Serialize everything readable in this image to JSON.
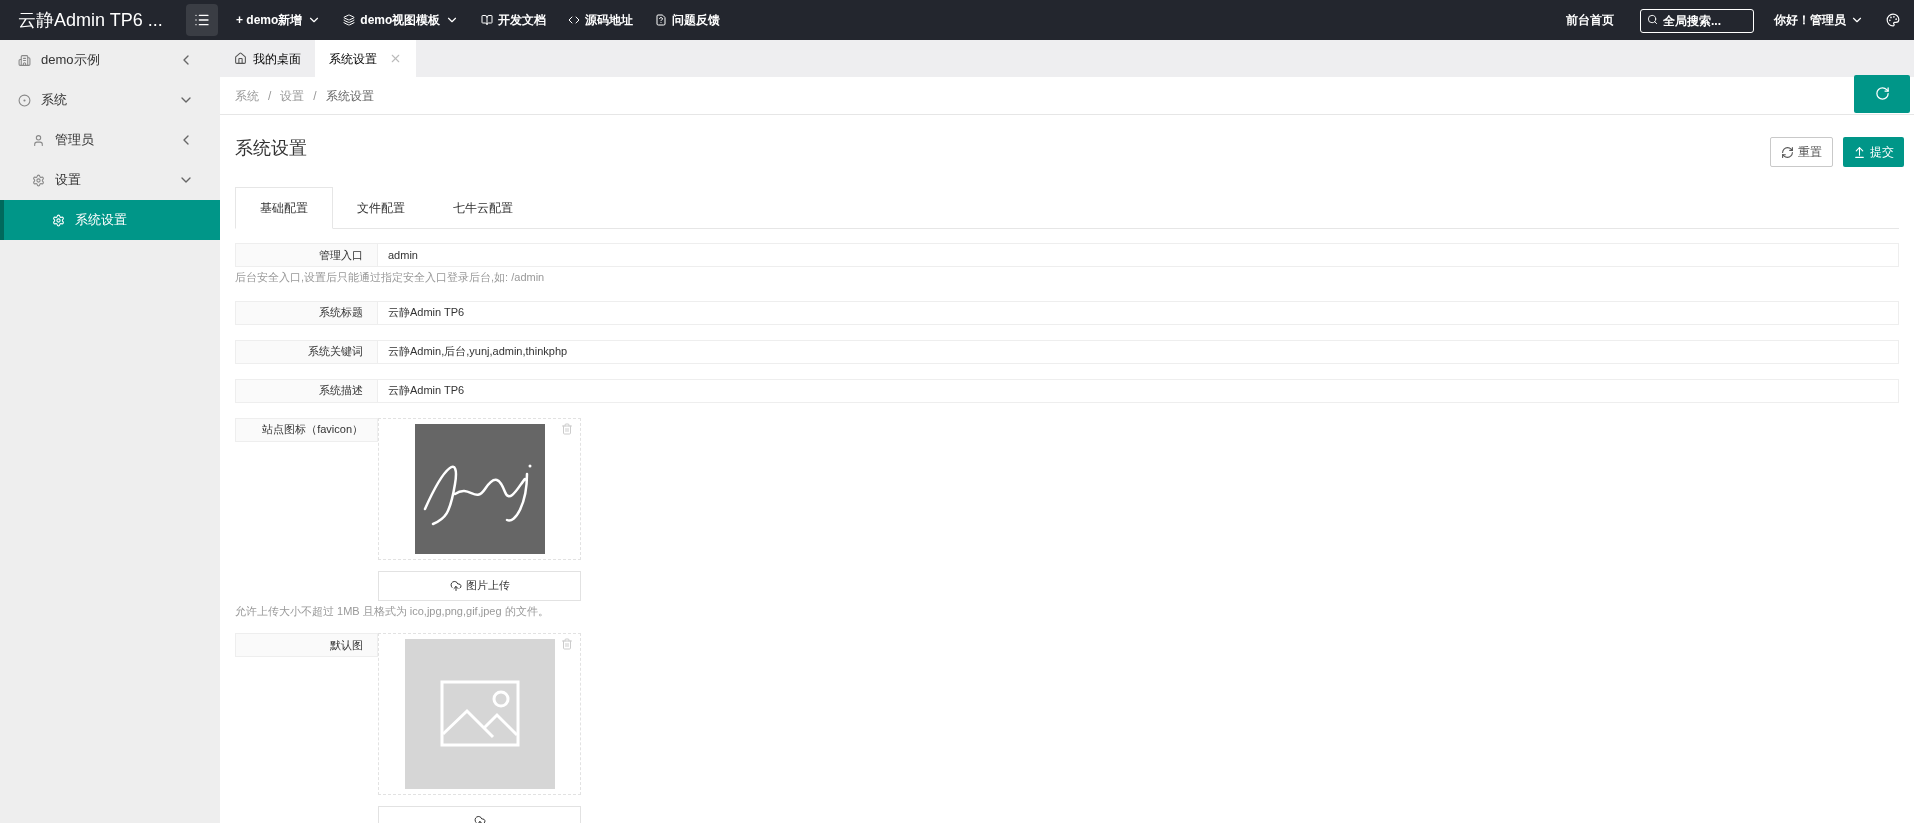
{
  "header": {
    "logo": "云静Admin TP6 ...",
    "nav": [
      {
        "label": "+ demo新增",
        "caret": true
      },
      {
        "label": "demo视图模板",
        "caret": true
      },
      {
        "label": "开发文档",
        "caret": false
      },
      {
        "label": "源码地址",
        "caret": false
      },
      {
        "label": "问题反馈",
        "caret": false
      }
    ],
    "home_link": "前台首页",
    "search": {
      "placeholder": "全局搜索..."
    },
    "user": "你好！管理员"
  },
  "sidebar": {
    "items": [
      {
        "label": "demo示例",
        "expanded": false,
        "selected": false
      },
      {
        "label": "系统",
        "expanded": true,
        "selected": false,
        "children": [
          {
            "label": "管理员",
            "expanded": false,
            "selected": false
          },
          {
            "label": "设置",
            "expanded": true,
            "selected": false,
            "children": [
              {
                "label": "系统设置",
                "selected": true
              }
            ]
          }
        ]
      }
    ]
  },
  "page_tabs": [
    {
      "label": "我的桌面",
      "selected": false,
      "closable": false
    },
    {
      "label": "系统设置",
      "selected": true,
      "closable": true
    }
  ],
  "breadcrumb": {
    "separator": "/",
    "items": [
      "系统",
      "设置",
      "系统设置"
    ]
  },
  "title": "系统设置",
  "buttons": {
    "reset": "重置",
    "submit": "提交"
  },
  "config_tabs": [
    {
      "label": "基础配置",
      "selected": true
    },
    {
      "label": "文件配置",
      "selected": false
    },
    {
      "label": "七牛云配置",
      "selected": false
    }
  ],
  "fields": [
    {
      "kind": "text",
      "label": "管理入口",
      "value": "admin",
      "hint": "后台安全入口,设置后只能通过指定安全入口登录后台,如: /admin"
    },
    {
      "kind": "text",
      "label": "系统标题",
      "value": "云静Admin TP6"
    },
    {
      "kind": "text",
      "label": "系统关键词",
      "value": "云静Admin,后台,yunj,admin,thinkphp"
    },
    {
      "kind": "text",
      "label": "系统描述",
      "value": "云静Admin TP6"
    },
    {
      "label": "站点图标（favicon）",
      "button": "图片上传",
      "hint": "允许上传大小不超过 1MB 且格式为 ico,jpg,png,gif,jpeg 的文件。"
    },
    {
      "label": "默认图"
    }
  ]
}
